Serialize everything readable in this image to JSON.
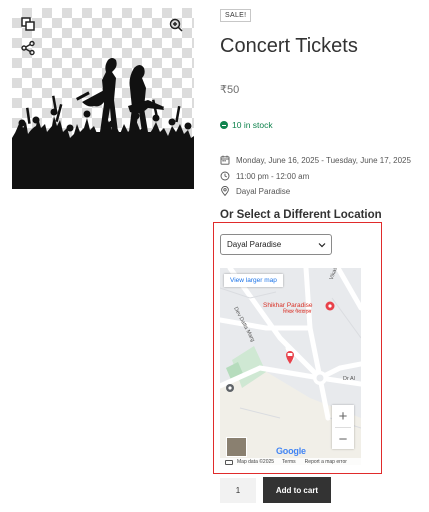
{
  "gallery": {
    "zoom_icon": "magnifier-plus-icon",
    "copy_icon": "copy-icon",
    "share_icon": "share-icon"
  },
  "product": {
    "badge": "SALE!",
    "title": "Concert Tickets",
    "price": "₹50",
    "stock": "10 in stock"
  },
  "event": {
    "dates": "Monday, June 16, 2025 - Tuesday, June 17, 2025",
    "times": "11:00 pm - 12:00 am",
    "location": "Dayal Paradise"
  },
  "location_section": {
    "heading": "Or Select a Different Location",
    "selected": "Dayal Paradise"
  },
  "map": {
    "larger_map": "View larger map",
    "place_name": "Shikhar Paradise",
    "place_name_hindi": "शिखर पैराडाइस",
    "road_marg": "Dev Datta Marg",
    "road_vikas": "Vikas Kh",
    "road_dr": "Dr Al",
    "zoom_in": "+",
    "zoom_out": "−",
    "logo": "Google",
    "footer_data": "Map data ©2025",
    "footer_terms": "Terms",
    "footer_report": "Report a map error"
  },
  "cart": {
    "quantity": "1",
    "add_label": "Add to cart"
  },
  "colors": {
    "stock_green": "#0f834d",
    "highlight_red": "#e02b2b",
    "button_dark": "#333333",
    "map_pin": "#e8414a"
  }
}
